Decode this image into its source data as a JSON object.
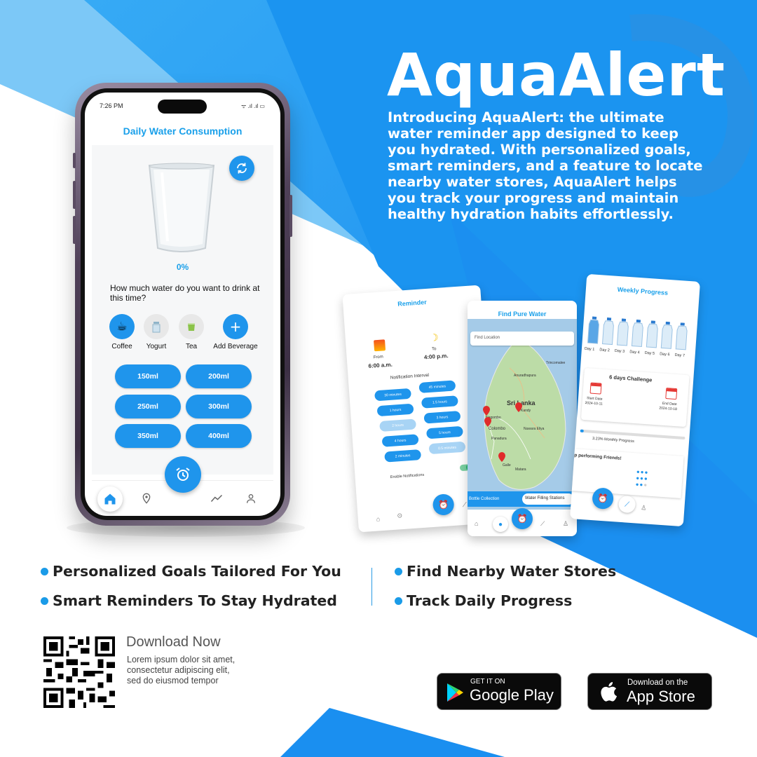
{
  "brand": {
    "title": "AquaAlert",
    "intro": "Introducing AquaAlert: the ultimate water reminder app designed to keep you hydrated. With personalized goals, smart reminders, and a feature to locate nearby water stores, AquaAlert helps you track your progress and maintain healthy hydration habits effortlessly.",
    "accent_color": "#1a9be8"
  },
  "main_phone": {
    "status_time": "7:26 PM",
    "status_icons": "ᯤ .ıl .ıl ▭",
    "screen_title": "Daily Water Consumption",
    "progress_percent": "0%",
    "question": "How much water do you want to drink at this time?",
    "beverages": [
      {
        "label": "Coffee",
        "icon": "coffee-cup-icon"
      },
      {
        "label": "Yogurt",
        "icon": "yogurt-bottle-icon"
      },
      {
        "label": "Tea",
        "icon": "tea-cup-icon"
      },
      {
        "label": "Add Beverage",
        "icon": "plus-icon"
      }
    ],
    "amounts": [
      "150ml",
      "200ml",
      "250ml",
      "300ml",
      "350ml",
      "400ml"
    ],
    "nav": [
      "home-icon",
      "location-pin-icon",
      "alarm-clock-icon",
      "trend-chart-icon",
      "profile-icon"
    ]
  },
  "reminder_screen": {
    "title": "Reminder",
    "from_label": "From",
    "from_time": "6:00 a.m.",
    "to_label": "To",
    "to_time": "4:00 p.m.",
    "interval_label": "Notification Interval",
    "intervals": [
      "30 minutes",
      "45 minutes",
      "1 hours",
      "1.5 hours",
      "2 hours",
      "3 hours",
      "4 hours",
      "5 hours",
      "2 minutes",
      "0.5 minutes"
    ],
    "toggle_label": "Enable Notifications",
    "toggle_on": true
  },
  "map_screen": {
    "title": "Find Pure Water",
    "search_placeholder": "Find Location",
    "places": [
      "Trincomalee",
      "Anuradhapura",
      "Sri Lanka",
      "Kandy",
      "Negombo",
      "Colombo",
      "Nuwara Eliya",
      "Panadura",
      "Galle",
      "Matara"
    ],
    "tabs": [
      "Bottle Collection",
      "Water Filling Stations"
    ],
    "active_tab": "Water Filling Stations"
  },
  "progress_screen": {
    "title": "Weekly Progress",
    "days": [
      "Day 1",
      "Day 2",
      "Day 3",
      "Day 4",
      "Day 5",
      "Day 6",
      "Day 7"
    ],
    "challenge_title": "6 days Challenge",
    "start_label": "Start Date",
    "start_date": "2024-10-11",
    "end_label": "End Date",
    "end_date": "2024-10-18",
    "monthly_progress": "3.23% Monthly Progress",
    "friends_title": "p performing Friends!"
  },
  "features": [
    "Personalized Goals Tailored For You",
    "Smart Reminders To Stay Hydrated",
    "Find Nearby Water Stores",
    "Track Daily Progress"
  ],
  "download": {
    "title": "Download Now",
    "text": "Lorem ipsum dolor sit amet, consectetur adipiscing elit, sed do eiusmod tempor",
    "google_small": "GET IT ON",
    "google_big": "Google Play",
    "apple_small": "Download on the",
    "apple_big": "App Store"
  }
}
